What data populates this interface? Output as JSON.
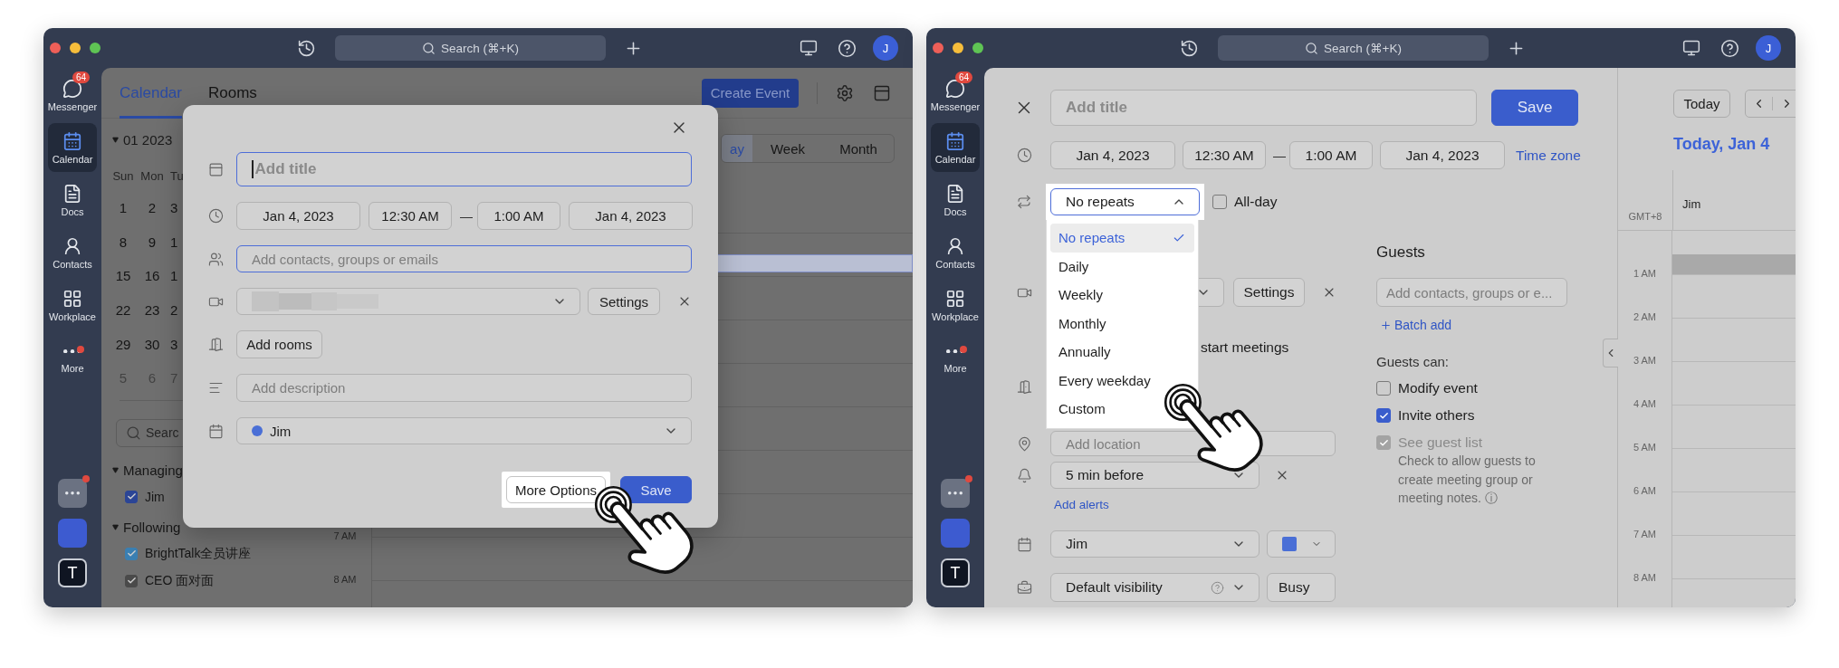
{
  "windows": [
    {
      "kind": "calendar_modal",
      "titlebar": {
        "search": "Search (⌘+K)",
        "avatar": "J"
      },
      "nav": {
        "items": [
          {
            "label": "Messenger",
            "badge": "64",
            "selected": false,
            "dot": false
          },
          {
            "label": "Calendar",
            "selected": true,
            "dot": false
          },
          {
            "label": "Docs",
            "selected": false,
            "dot": false
          },
          {
            "label": "Contacts",
            "selected": false,
            "dot": false
          },
          {
            "label": "Workplace",
            "selected": false,
            "dot": false
          },
          {
            "label": "More",
            "selected": false,
            "dot": true
          }
        ],
        "apps": [
          {
            "kind": "more",
            "dot": true
          },
          {
            "kind": "app"
          },
          {
            "kind": "letter",
            "text": "T"
          }
        ]
      },
      "calendar_view": {
        "tabs": [
          {
            "label": "Calendar",
            "selected": true
          },
          {
            "label": "Rooms",
            "selected": false
          }
        ],
        "create_button": "Create Event",
        "month": "01 2023",
        "weekdays": [
          "Sun",
          "Mon",
          "Tu"
        ],
        "weeks": [
          {
            "days": [
              "1",
              "2",
              "3"
            ],
            "muted": false
          },
          {
            "days": [
              "8",
              "9",
              "1"
            ],
            "muted": false
          },
          {
            "days": [
              "15",
              "16",
              "1"
            ],
            "muted": false
          },
          {
            "days": [
              "22",
              "23",
              "2"
            ],
            "muted": false
          },
          {
            "days": [
              "29",
              "30",
              "3"
            ],
            "muted": false
          },
          {
            "days": [
              "5",
              "6",
              "7"
            ],
            "muted": true
          }
        ],
        "search": {
          "placeholder": "Searc"
        },
        "groups": [
          {
            "title": "Managing",
            "expanded": true,
            "items": [
              {
                "label": "Jim",
                "checked": true,
                "color": "#2b4596"
              }
            ]
          },
          {
            "title": "Following",
            "expanded": true,
            "items": [
              {
                "label": "BrightTalk全员讲座",
                "checked": true,
                "color": "#3a7fb2"
              },
              {
                "label": "CEO 面对面",
                "checked": true,
                "color": "#4a4a4a"
              }
            ]
          }
        ],
        "views": [
          {
            "label": "ay",
            "selected": true
          },
          {
            "label": "Week",
            "selected": false
          },
          {
            "label": "Month",
            "selected": false
          }
        ],
        "hours": [
          "7 AM",
          "8 AM"
        ]
      },
      "modal": {
        "title": {
          "placeholder": "Add title",
          "focused": true
        },
        "times": [
          "Jan 4, 2023",
          "12:30 AM",
          "1:00 AM",
          "Jan 4, 2023"
        ],
        "separator": "—",
        "guests": {
          "placeholder": "Add contacts, groups or emails",
          "focused": true
        },
        "meeting": {
          "settings": "Settings"
        },
        "rooms": "Add rooms",
        "description": {
          "placeholder": "Add description",
          "focused": false
        },
        "calendar": {
          "name": "Jim",
          "color": "#4a6fd6"
        },
        "buttons": [
          {
            "label": "More Options",
            "kind": "secondary",
            "highlighted": true
          },
          {
            "label": "Save",
            "kind": "primary",
            "highlighted": false
          }
        ]
      }
    },
    {
      "kind": "event_editor",
      "titlebar": {
        "search": "Search (⌘+K)",
        "avatar": "J"
      },
      "nav": {
        "items": [
          {
            "label": "Messenger",
            "badge": "64",
            "selected": false,
            "dot": false
          },
          {
            "label": "Calendar",
            "selected": true,
            "dot": false
          },
          {
            "label": "Docs",
            "selected": false,
            "dot": false
          },
          {
            "label": "Contacts",
            "selected": false,
            "dot": false
          },
          {
            "label": "Workplace",
            "selected": false,
            "dot": false
          },
          {
            "label": "More",
            "selected": false,
            "dot": true
          }
        ],
        "apps": [
          {
            "kind": "more",
            "dot": true
          },
          {
            "kind": "app"
          },
          {
            "kind": "letter",
            "text": "T"
          }
        ]
      },
      "event_form": {
        "title": {
          "placeholder": "Add title"
        },
        "save": "Save",
        "times": [
          "Jan 4, 2023",
          "12:30 AM",
          "1:00 AM",
          "Jan 4, 2023"
        ],
        "separator": "—",
        "time_zone": "Time zone",
        "repeat": {
          "value": "No repeats",
          "expanded": true,
          "highlighted": true,
          "options": [
            {
              "label": "No repeats",
              "selected": true
            },
            {
              "label": "Daily",
              "selected": false
            },
            {
              "label": "Weekly",
              "selected": false
            },
            {
              "label": "Monthly",
              "selected": false
            },
            {
              "label": "Annually",
              "selected": false
            },
            {
              "label": "Every weekday",
              "selected": false
            },
            {
              "label": "Custom",
              "selected": false
            }
          ]
        },
        "all_day": {
          "label": "All-day",
          "checked": false
        },
        "meeting": {
          "settings": "Settings"
        },
        "meeting_option_text": "start meetings",
        "location": {
          "placeholder": "Add location"
        },
        "alert": {
          "value": "5 min before"
        },
        "add_alerts": "Add alerts",
        "calendar": {
          "value": "Jim",
          "color": "#4a6fd6"
        },
        "visibility": {
          "value": "Default visibility"
        },
        "availability": {
          "value": "Busy"
        },
        "guests": {
          "title": "Guests",
          "placeholder": "Add contacts, groups or e...",
          "batch_add": "Batch add",
          "permissions_title": "Guests can:",
          "permissions": [
            {
              "label": "Modify event",
              "checked": false,
              "disabled": false
            },
            {
              "label": "Invite others",
              "checked": true,
              "disabled": false
            },
            {
              "label": "See guest list",
              "checked": true,
              "disabled": true
            }
          ],
          "note": "Check to allow guests to create meeting group or meeting notes. ⓘ"
        }
      },
      "day_view": {
        "today": "Today",
        "date": "Today, Jan 4",
        "timezone": "GMT+8",
        "column": "Jim",
        "hours": [
          "1 AM",
          "2 AM",
          "3 AM",
          "4 AM",
          "5 AM",
          "6 AM",
          "7 AM",
          "8 AM"
        ]
      }
    }
  ]
}
